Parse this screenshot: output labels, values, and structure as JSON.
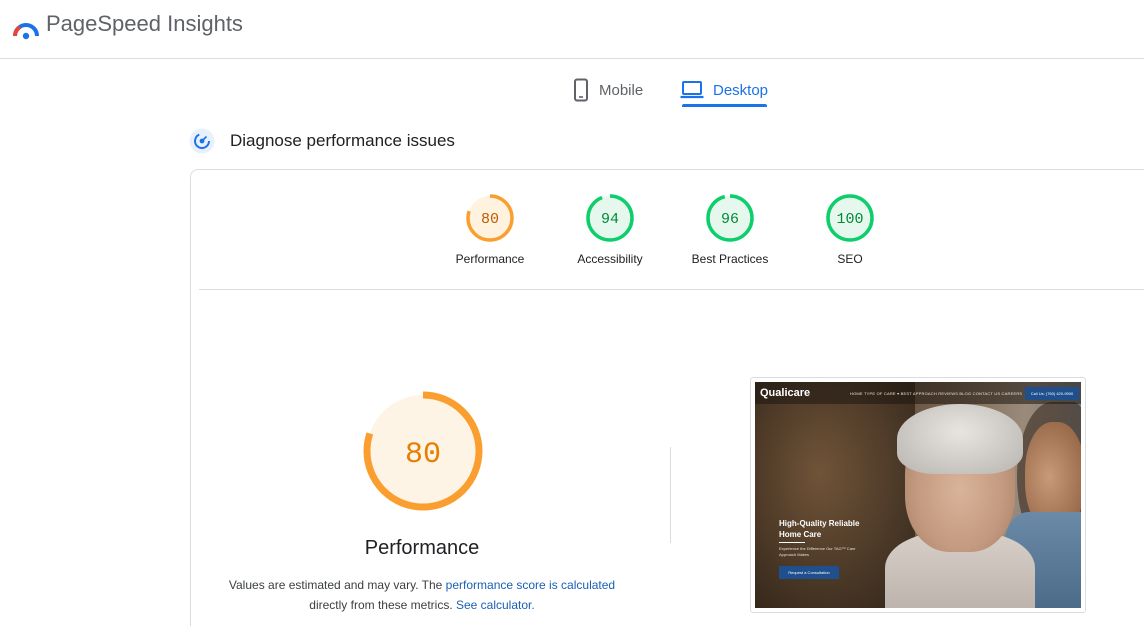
{
  "app": {
    "title": "PageSpeed Insights",
    "logo_icon": "pagespeed-logo-icon",
    "brand_colors": {
      "blue": "#1a73e8",
      "red": "#ea4335",
      "green": "#34a853",
      "yellow": "#fbbc04"
    }
  },
  "tabs": [
    {
      "label": "Mobile",
      "icon": "smartphone-icon",
      "selected": false
    },
    {
      "label": "Desktop",
      "icon": "laptop-icon",
      "selected": true
    }
  ],
  "section": {
    "title": "Diagnose performance issues",
    "icon": "diagnose-gauge-icon"
  },
  "categories": [
    {
      "label": "Performance",
      "score": "80",
      "status": "average"
    },
    {
      "label": "Accessibility",
      "score": "94",
      "status": "pass"
    },
    {
      "label": "Best Practices",
      "score": "96",
      "status": "pass"
    },
    {
      "label": "SEO",
      "score": "100",
      "status": "pass"
    }
  ],
  "status_colors": {
    "average": {
      "stroke": "#fa9f2f",
      "fill": "#fff3e0",
      "text": "#c05a00"
    },
    "pass": {
      "stroke": "#0cce6b",
      "fill": "#e6f8ee",
      "text": "#008a35"
    }
  },
  "main_score": {
    "score": "80",
    "label": "Performance",
    "color": "#fa9f2f",
    "fill": "#fef4e6",
    "text_color": "#e67e00"
  },
  "note": {
    "text_before": "Values are estimated and may vary. The ",
    "link1": "performance score is calculated",
    "text_middle": " directly from these metrics. ",
    "link2": "See calculator."
  },
  "screenshot": {
    "brand": "Qualicare",
    "nav_links": "HOME  TYPE OF CARE ▾  BEST APPROACH  REVIEWS  BLOG  CONTACT US  CAREERS",
    "call_button": "Call Us: (760) 420-9900",
    "headline": "High-Quality Reliable Home Care",
    "subtext": "Experience the Difference Our TAG™ Care Approach Makes",
    "cta": "Request a Consultation"
  }
}
